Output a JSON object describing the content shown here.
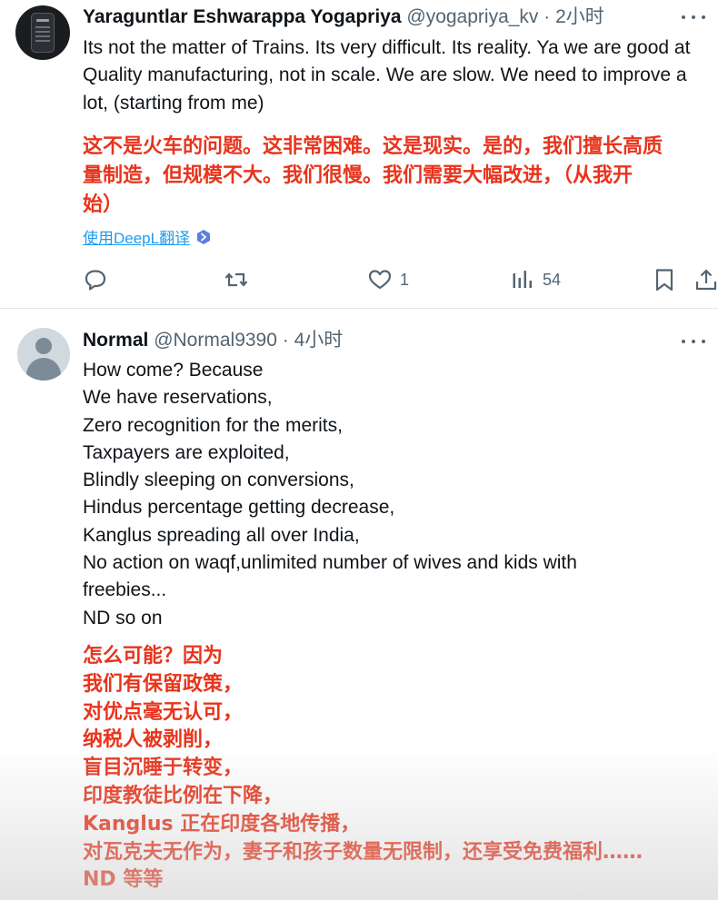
{
  "tweet1": {
    "display_name": "Yaraguntlar Eshwarappa Yogapriya",
    "handle": "@yogapriya_kv",
    "separator": "·",
    "time": "2小时",
    "text": "Its not the matter of Trains. Its very difficult. Its reality. Ya we are good at Quality manufacturing, not in scale. We are slow. We need to improve a lot, (starting from me)",
    "translation_lines": [
      "这不是火车的问题。这非常困难。这是现实。是的，我们擅长高质",
      "量制造，但规模不大。我们很慢。我们需要大幅改进，（从我开",
      "始）"
    ],
    "translate_link": "使用DeepL翻译",
    "actions": {
      "reply_icon": "reply-icon",
      "retweet_icon": "retweet-icon",
      "like_icon": "heart-icon",
      "like_count": "1",
      "views_icon": "views-bar-chart-icon",
      "views_count": "54",
      "bookmark_icon": "bookmark-icon",
      "share_icon": "share-icon"
    }
  },
  "tweet2": {
    "display_name": "Normal",
    "handle": "@Normal9390",
    "separator": "·",
    "time": "4小时",
    "lines": [
      "How come? Because",
      "We have reservations,",
      "Zero recognition for the merits,",
      "Taxpayers are exploited,",
      "Blindly sleeping on conversions,",
      "Hindus percentage getting decrease,",
      "Kanglus spreading all over India,",
      "No action on waqf,unlimited number of wives and kids with",
      "freebies...",
      "ND so on"
    ],
    "translation_lines": [
      "怎么可能？因为",
      "我们有保留政策，",
      "对优点毫无认可，",
      "纳税人被剥削，",
      "盲目沉睡于转变，",
      "印度教徒比例在下降，",
      "Kanglus 正在印度各地传播，",
      "对瓦克夫无作为，妻子和孩子数量无限制，还享受免费福利……",
      "ND 等等"
    ]
  },
  "colors": {
    "translation": "#e8341c",
    "link": "#1d9bf0",
    "secondary": "#536471",
    "primary_text": "#0f1419"
  }
}
